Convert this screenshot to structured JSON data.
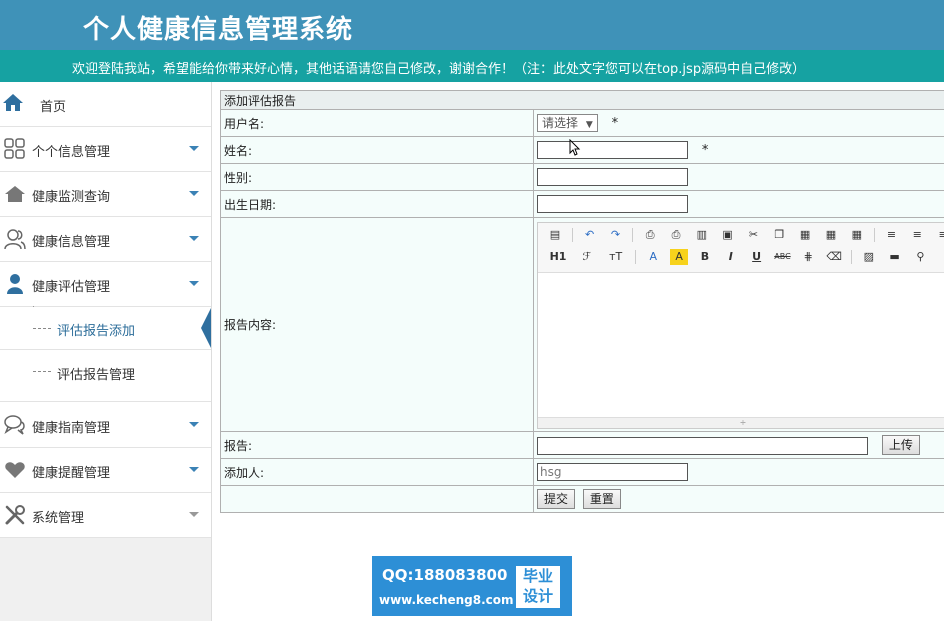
{
  "header": {
    "title": "个人健康信息管理系统"
  },
  "banner": {
    "text": "欢迎登陆我站，希望能给你带来好心情，其他话语请您自己修改，谢谢合作！（注：此处文字您可以在top.jsp源码中自己修改）"
  },
  "sidebar": {
    "home": "首页",
    "items": [
      {
        "label": "个个信息管理",
        "icon": "grid-icon"
      },
      {
        "label": "健康监测查询",
        "icon": "home-icon"
      },
      {
        "label": "健康信息管理",
        "icon": "users-icon"
      },
      {
        "label": "健康评估管理",
        "icon": "user-icon"
      }
    ],
    "subitems": [
      {
        "label": "评估报告添加",
        "active": true
      },
      {
        "label": "评估报告管理",
        "active": false
      }
    ],
    "items_after": [
      {
        "label": "健康指南管理",
        "icon": "chat-icon"
      },
      {
        "label": "健康提醒管理",
        "icon": "heart-icon"
      },
      {
        "label": "系统管理",
        "icon": "tools-icon"
      }
    ]
  },
  "form": {
    "caption": "添加评估报告",
    "username_label": "用户名:",
    "username_select": "请选择",
    "name_label": "姓名:",
    "gender_label": "性别:",
    "birth_label": "出生日期:",
    "content_label": "报告内容:",
    "report_label": "报告:",
    "upload_button": "上传",
    "adder_label": "添加人:",
    "adder_value": "hsg",
    "submit_button": "提交",
    "reset_button": "重置",
    "required_mark": "*"
  },
  "editor": {
    "heading_btn": "H1",
    "font_btn": "ℱ",
    "size_btn": "ᴛT",
    "fontcolor_btn": "A",
    "bgcolor_btn": "A",
    "bold_btn": "B",
    "italic_btn": "I",
    "underline_btn": "U",
    "strike_btn": "ABC"
  },
  "watermark": {
    "qq": "QQ:188083800",
    "url": "www.kecheng8.com",
    "badge_line1": "毕业",
    "badge_line2": "设计"
  },
  "colors": {
    "header": "#3f92b8",
    "banner": "#16a2a2",
    "accent": "#2f6f9f",
    "form_bg": "#f4fdfb"
  }
}
